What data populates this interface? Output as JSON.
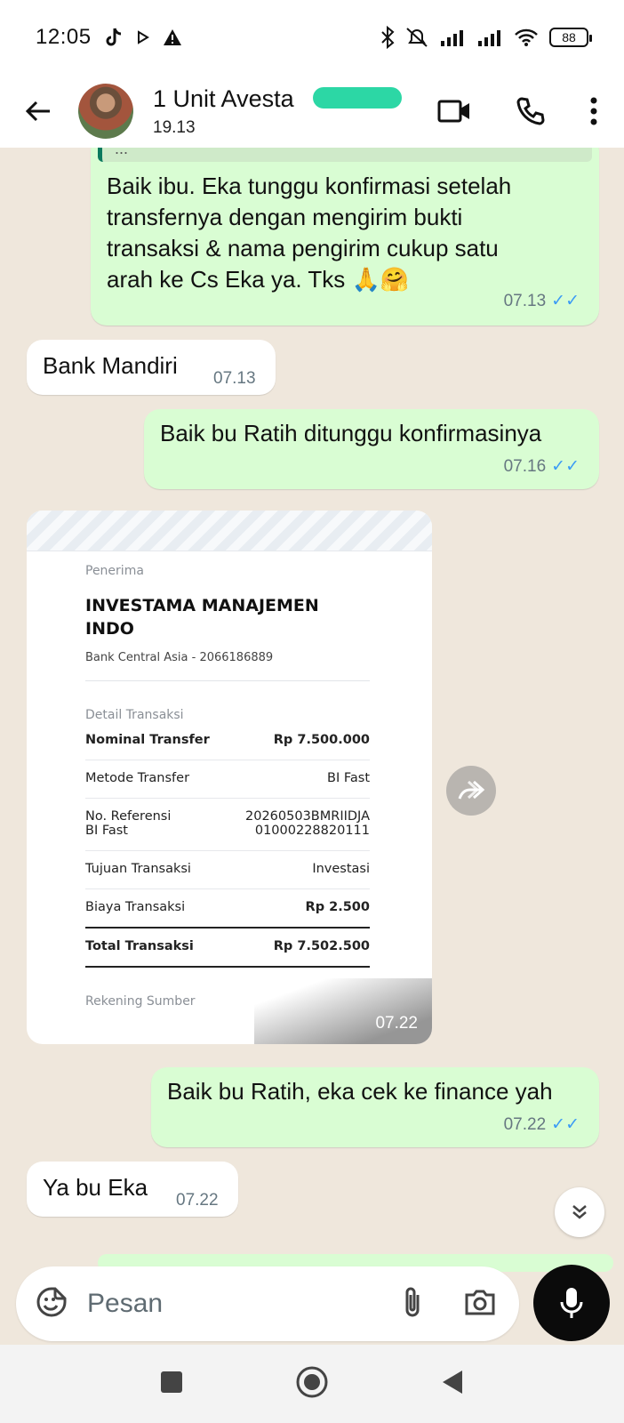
{
  "status_bar": {
    "time": "12:05",
    "battery": "88"
  },
  "header": {
    "contact_name": "1 Unit Avesta",
    "contact_subtitle": "19.13"
  },
  "messages": [
    {
      "id": "m1",
      "direction": "outgoing",
      "quote_text": "...",
      "text": "Baik ibu. Eka tunggu konfirmasi setelah transfernya dengan mengirim bukti transaksi & nama pengirim cukup satu arah ke Cs Eka ya. Tks 🙏🤗",
      "lines": [
        "Baik ibu. Eka tunggu konfirmasi setelah",
        "transfernya dengan mengirim bukti",
        "transaksi & nama pengirim cukup satu",
        "arah ke Cs Eka ya. Tks 🙏🤗"
      ],
      "time": "07.13",
      "ticks": "✓✓"
    },
    {
      "id": "m2",
      "direction": "incoming",
      "text": "Bank Mandiri",
      "time": "07.13"
    },
    {
      "id": "m3",
      "direction": "outgoing",
      "text": "Baik bu Ratih ditunggu konfirmasinya",
      "time": "07.16",
      "ticks": "✓✓"
    },
    {
      "id": "m4",
      "direction": "incoming",
      "type": "image",
      "time": "07.22",
      "receipt": {
        "recipient_label": "Penerima",
        "recipient_name_line1": "INVESTAMA MANAJEMEN",
        "recipient_name_line2": "INDO",
        "bank": "Bank Central Asia - 2066186889",
        "details_label": "Detail Transaksi",
        "rows": [
          {
            "key": "Nominal Transfer",
            "value": "Rp 7.500.000"
          },
          {
            "key": "Metode Transfer",
            "value": "BI Fast"
          },
          {
            "key": "No. Referensi\nBI Fast",
            "value": "20260503BMRIIDJA\n01000228820111"
          },
          {
            "key": "Tujuan Transaksi",
            "value": "Investasi"
          },
          {
            "key": "Biaya Transaksi",
            "value": "Rp 2.500"
          },
          {
            "key": "Total Transaksi",
            "value": "Rp 7.502.500"
          }
        ],
        "footer_label": "Rekening Sumber"
      }
    },
    {
      "id": "m5",
      "direction": "outgoing",
      "text": "Baik bu Ratih, eka cek ke finance yah",
      "time": "07.22",
      "ticks": "✓✓"
    },
    {
      "id": "m6",
      "direction": "incoming",
      "text": "Ya bu Eka",
      "time": "07.22"
    }
  ],
  "composer": {
    "placeholder": "Pesan"
  },
  "colors": {
    "outgoing_bubble": "#d9fdd3",
    "incoming_bubble": "#ffffff",
    "chat_background": "#efe7dc",
    "read_ticks": "#3b9bf5"
  },
  "icons": {
    "back": "arrow-left-icon",
    "video_call": "video-icon",
    "voice_call": "phone-icon",
    "menu": "more-vertical-icon",
    "sticker": "sticker-icon",
    "attach": "paperclip-icon",
    "camera": "camera-icon",
    "mic": "mic-icon",
    "forward": "forward-icon",
    "scroll_down": "double-chevron-down-icon"
  }
}
